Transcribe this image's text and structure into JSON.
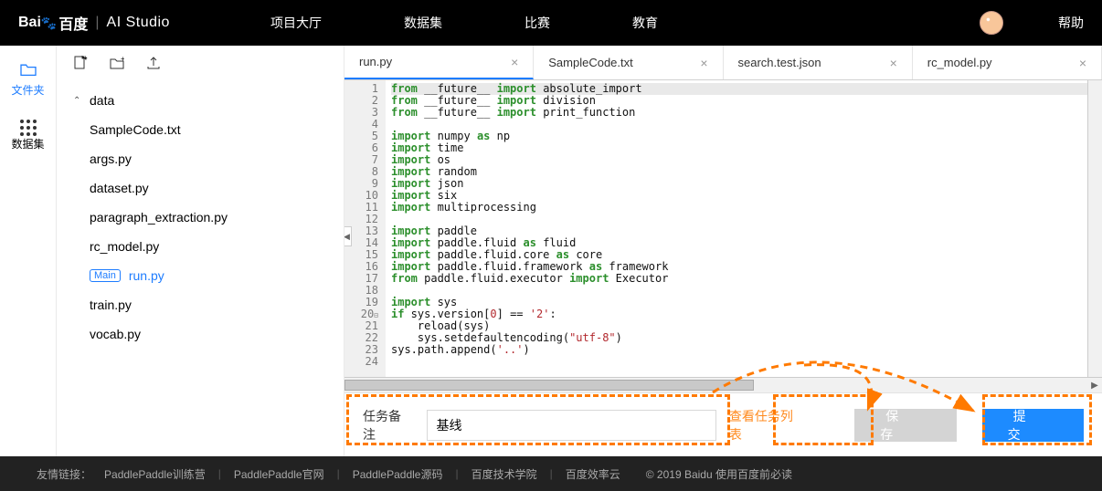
{
  "header": {
    "logo_baidu": "Bai",
    "logo_du": "百度",
    "logo_studio": "AI Studio",
    "nav": [
      "项目大厅",
      "数据集",
      "比赛",
      "教育"
    ],
    "help": "帮助"
  },
  "rail": {
    "files": "文件夹",
    "datasets": "数据集"
  },
  "tree": {
    "folder": "data",
    "items": [
      "SampleCode.txt",
      "args.py",
      "dataset.py",
      "paragraph_extraction.py",
      "rc_model.py"
    ],
    "main_tag": "Main",
    "main_file": "run.py",
    "rest": [
      "train.py",
      "vocab.py"
    ]
  },
  "tabs": [
    {
      "label": "run.py",
      "active": true
    },
    {
      "label": "SampleCode.txt",
      "active": false
    },
    {
      "label": "search.test.json",
      "active": false
    },
    {
      "label": "rc_model.py",
      "active": false
    }
  ],
  "code": {
    "lines": 24,
    "content": [
      [
        [
          "kw",
          "from"
        ],
        [
          "id",
          " __future__ "
        ],
        [
          "kw",
          "import"
        ],
        [
          "id",
          " absolute_import"
        ]
      ],
      [
        [
          "kw",
          "from"
        ],
        [
          "id",
          " __future__ "
        ],
        [
          "kw",
          "import"
        ],
        [
          "id",
          " division"
        ]
      ],
      [
        [
          "kw",
          "from"
        ],
        [
          "id",
          " __future__ "
        ],
        [
          "kw",
          "import"
        ],
        [
          "id",
          " print_function"
        ]
      ],
      [],
      [
        [
          "kw",
          "import"
        ],
        [
          "id",
          " numpy "
        ],
        [
          "kw",
          "as"
        ],
        [
          "id",
          " np"
        ]
      ],
      [
        [
          "kw",
          "import"
        ],
        [
          "id",
          " time"
        ]
      ],
      [
        [
          "kw",
          "import"
        ],
        [
          "id",
          " os"
        ]
      ],
      [
        [
          "kw",
          "import"
        ],
        [
          "id",
          " random"
        ]
      ],
      [
        [
          "kw",
          "import"
        ],
        [
          "id",
          " json"
        ]
      ],
      [
        [
          "kw",
          "import"
        ],
        [
          "id",
          " six"
        ]
      ],
      [
        [
          "kw",
          "import"
        ],
        [
          "id",
          " multiprocessing"
        ]
      ],
      [],
      [
        [
          "kw",
          "import"
        ],
        [
          "id",
          " paddle"
        ]
      ],
      [
        [
          "kw",
          "import"
        ],
        [
          "id",
          " paddle.fluid "
        ],
        [
          "kw",
          "as"
        ],
        [
          "id",
          " fluid"
        ]
      ],
      [
        [
          "kw",
          "import"
        ],
        [
          "id",
          " paddle.fluid.core "
        ],
        [
          "kw",
          "as"
        ],
        [
          "id",
          " core"
        ]
      ],
      [
        [
          "kw",
          "import"
        ],
        [
          "id",
          " paddle.fluid.framework "
        ],
        [
          "kw",
          "as"
        ],
        [
          "id",
          " framework"
        ]
      ],
      [
        [
          "kw",
          "from"
        ],
        [
          "id",
          " paddle.fluid.executor "
        ],
        [
          "kw",
          "import"
        ],
        [
          "id",
          " Executor"
        ]
      ],
      [],
      [
        [
          "kw",
          "import"
        ],
        [
          "id",
          " sys"
        ]
      ],
      [
        [
          "kw",
          "if"
        ],
        [
          "id",
          " sys.version["
        ],
        [
          "num",
          "0"
        ],
        [
          "id",
          "] "
        ],
        [
          "op",
          "=="
        ],
        [
          "id",
          " "
        ],
        [
          "str",
          "'2'"
        ],
        [
          "id",
          ":"
        ]
      ],
      [
        [
          "id",
          "    reload(sys)"
        ]
      ],
      [
        [
          "id",
          "    sys.setdefaultencoding("
        ],
        [
          "str",
          "\"utf-8\""
        ],
        [
          "id",
          ")"
        ]
      ],
      [
        [
          "id",
          "sys.path.append("
        ],
        [
          "str",
          "'..'"
        ],
        [
          "id",
          ")"
        ]
      ],
      []
    ]
  },
  "bottom": {
    "task_label": "任务备注",
    "task_value": "基线",
    "view_tasks": "查看任务列表",
    "save": "保 存",
    "submit": "提 交"
  },
  "footer": {
    "prefix": "友情链接：",
    "links": [
      "PaddlePaddle训练营",
      "PaddlePaddle官网",
      "PaddlePaddle源码",
      "百度技术学院",
      "百度效率云"
    ],
    "copyright": "© 2019 Baidu 使用百度前必读"
  }
}
